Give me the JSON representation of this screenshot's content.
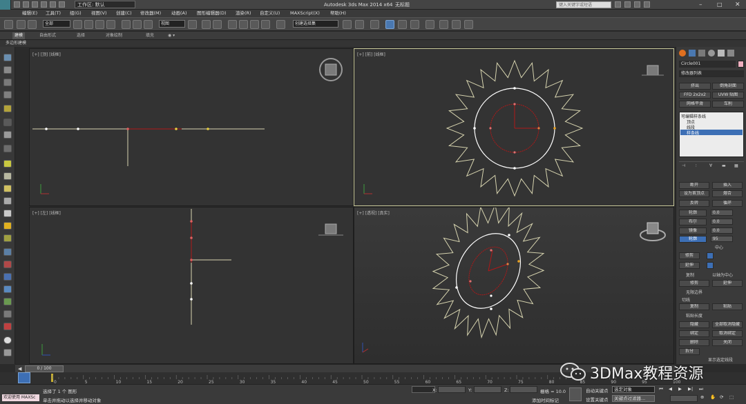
{
  "title_bar": {
    "workspace_label": "工作区: 默认",
    "app_title": "Autodesk 3ds Max  2014 x64",
    "doc_title": "无标题",
    "search_placeholder": "键入关键字或短语"
  },
  "menu": [
    "编辑(E)",
    "工具(T)",
    "组(G)",
    "视图(V)",
    "创建(C)",
    "修改器(M)",
    "动画(A)",
    "图形编辑器(D)",
    "渲染(R)",
    "自定义(U)",
    "MAXScript(X)",
    "帮助(H)"
  ],
  "toolbar": {
    "selection_filter": "全部",
    "ref_coord": "视图",
    "named_selection": "创建选择集"
  },
  "ribbon": {
    "tabs": [
      "建模",
      "自由形式",
      "选择",
      "对象绘制",
      "填充"
    ],
    "subtitle": "多边形建模"
  },
  "viewports": {
    "top_left_label": "[+] [顶] [线框]",
    "top_right_label": "[+] [前] [线框]",
    "bottom_left_label": "[+] [左] [线框]",
    "bottom_right_label": "[+] [透视] [真实]"
  },
  "command_panel": {
    "object_name": "Circle001",
    "modifier_list": "修改器列表",
    "buttons": [
      "挤出",
      "倒角剖面",
      "FFD 2x2x2",
      "UVW 贴图",
      "网格平滑",
      "车削"
    ],
    "stack": [
      "可编辑样条线",
      "顶点",
      "线段",
      "样条线"
    ],
    "stack_selected": "样条线",
    "ops": {
      "insert_left": "断开",
      "insert_right": "插入",
      "attach": "设为首顶点",
      "attach_right": "熔合",
      "reverse": "反转",
      "cycle": "循环",
      "outline": "轮廓",
      "outline_value": "0.0",
      "boolean": "布尔",
      "boolean_value": "0.0",
      "mirror": "镜像",
      "mirror_value": "0.0",
      "section": "轮廓",
      "section_value": "95",
      "center": "中心",
      "trim": "修剪",
      "extend": "延伸",
      "copy": "复制",
      "about_pivot": "以轴为中心",
      "trim2": "修剪",
      "extend2": "延伸",
      "infinite": "无限边界",
      "tangent": "切线",
      "tcopy": "复制",
      "tpaste": "粘贴",
      "paste_length": "粘贴长度",
      "hide": "隐藏",
      "unhide_all": "全部取消隐藏",
      "bind": "绑定",
      "unbind": "取消绑定",
      "delete": "删除",
      "close": "关闭",
      "explode": "拆分",
      "show_sel": "显示选定线段"
    }
  },
  "timeline": {
    "frame_counter": "0 / 100",
    "ticks": [
      "0",
      "5",
      "10",
      "15",
      "20",
      "25",
      "30",
      "35",
      "40",
      "45",
      "50",
      "55",
      "60",
      "65",
      "70",
      "75",
      "80",
      "85",
      "90",
      "95",
      "100"
    ]
  },
  "status": {
    "listener": "欢迎使用 MAXSc",
    "line1": "选择了 1 个 图形",
    "line2": "单击并拖动以选择并移动对象",
    "grid": "栅格 = 10.0",
    "auto_key": "自动关键点",
    "set_key": "设置关键点",
    "selected": "选定对象",
    "key_filters": "关键点过滤器...",
    "add_time_tag": "添加时间标记",
    "x_label": "X:",
    "y_label": "Y:",
    "z_label": "Z:"
  },
  "watermark": "3DMax教程资源",
  "colors": {
    "viewport_bg": "#333333",
    "selected_spline": "#ffffff",
    "star_spline": "#d8d5b0",
    "vertex_red": "#b01818",
    "highlight_blue": "#3d6fb5"
  }
}
